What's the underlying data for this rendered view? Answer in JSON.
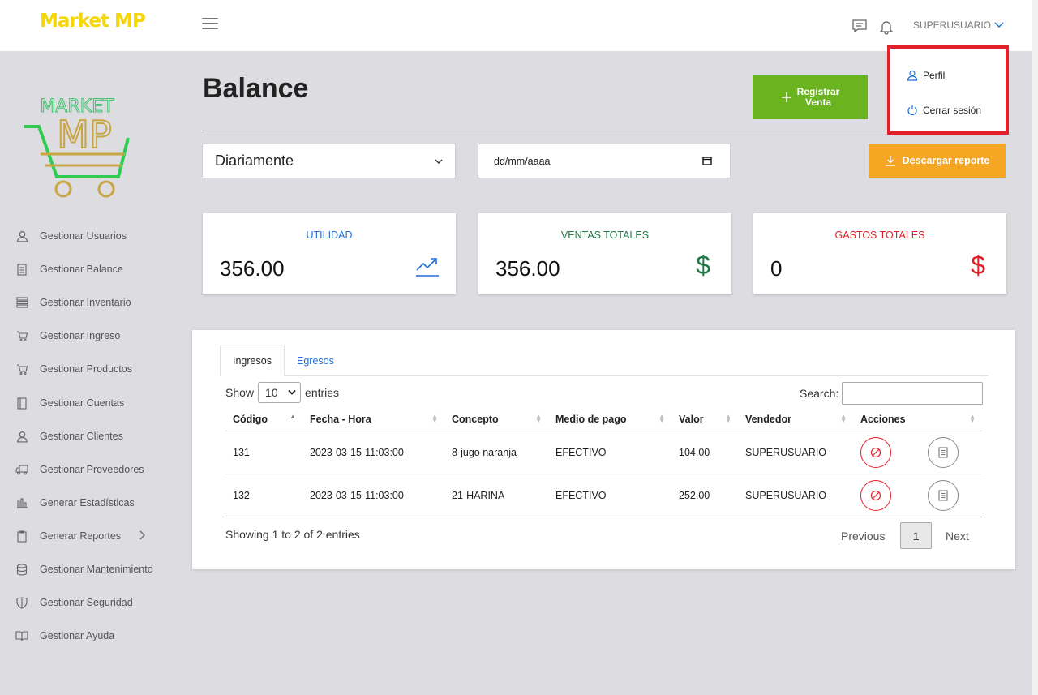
{
  "app": {
    "brand": "Market MP",
    "user_name": "SUPERUSUARIO"
  },
  "user_dropdown": {
    "items": [
      {
        "label": "Perfil",
        "icon": "user-icon"
      },
      {
        "label": "Cerrar sesión",
        "icon": "power-icon"
      }
    ]
  },
  "logo": {
    "line1": "MARKET",
    "line2": "MP"
  },
  "sidebar": {
    "items": [
      {
        "label": "Gestionar Usuarios",
        "icon": "user-icon"
      },
      {
        "label": "Gestionar Balance",
        "icon": "receipt-icon"
      },
      {
        "label": "Gestionar Inventario",
        "icon": "server-icon"
      },
      {
        "label": "Gestionar Ingreso",
        "icon": "cart-icon"
      },
      {
        "label": "Gestionar Productos",
        "icon": "cart-icon"
      },
      {
        "label": "Gestionar Cuentas",
        "icon": "book-icon"
      },
      {
        "label": "Gestionar Clientes",
        "icon": "user-icon"
      },
      {
        "label": "Gestionar Proveedores",
        "icon": "truck-icon"
      },
      {
        "label": "Generar Estadísticas",
        "icon": "bar-chart-icon"
      },
      {
        "label": "Generar Reportes",
        "icon": "clipboard-icon"
      },
      {
        "label": "Gestionar Mantenimiento",
        "icon": "database-icon"
      },
      {
        "label": "Gestionar Seguridad",
        "icon": "shield-icon"
      },
      {
        "label": "Gestionar Ayuda",
        "icon": "book-open-icon"
      }
    ]
  },
  "main": {
    "title": "Balance",
    "register_button": {
      "line1": "Registrar",
      "line2": "Venta"
    },
    "period_select": {
      "value": "Diariamente"
    },
    "date_input": {
      "placeholder": "dd/mm/aaaa"
    },
    "download_button": "Descargar reporte",
    "colors": {
      "green": "#6ab41f",
      "orange": "#f5a623",
      "blue": "#1e6fd9",
      "dark_green": "#1e7a46",
      "red": "#e2202a"
    }
  },
  "cards": [
    {
      "title": "UTILIDAD",
      "value": "356.00",
      "icon": "trending-up-icon"
    },
    {
      "title": "VENTAS TOTALES",
      "value": "356.00",
      "icon": "dollar-icon"
    },
    {
      "title": "GASTOS TOTALES",
      "value": "0",
      "icon": "dollar-icon"
    }
  ],
  "table": {
    "tabs": [
      "Ingresos",
      "Egresos"
    ],
    "show_label": "Show",
    "entries_label": "entries",
    "length_value": "10",
    "search_label": "Search:",
    "columns": [
      "Código",
      "Fecha - Hora",
      "Concepto",
      "Medio de pago",
      "Valor",
      "Vendedor",
      "Acciones"
    ],
    "rows": [
      {
        "codigo": "131",
        "fecha": "2023-03-15-11:03:00",
        "concepto": "8-jugo naranja",
        "medio": "EFECTIVO",
        "valor": "104.00",
        "vendedor": "SUPERUSUARIO"
      },
      {
        "codigo": "132",
        "fecha": "2023-03-15-11:03:00",
        "concepto": "21-HARINA",
        "medio": "EFECTIVO",
        "valor": "252.00",
        "vendedor": "SUPERUSUARIO"
      }
    ],
    "info": "Showing 1 to 2 of 2 entries",
    "pagination": {
      "previous": "Previous",
      "current": "1",
      "next": "Next"
    }
  }
}
